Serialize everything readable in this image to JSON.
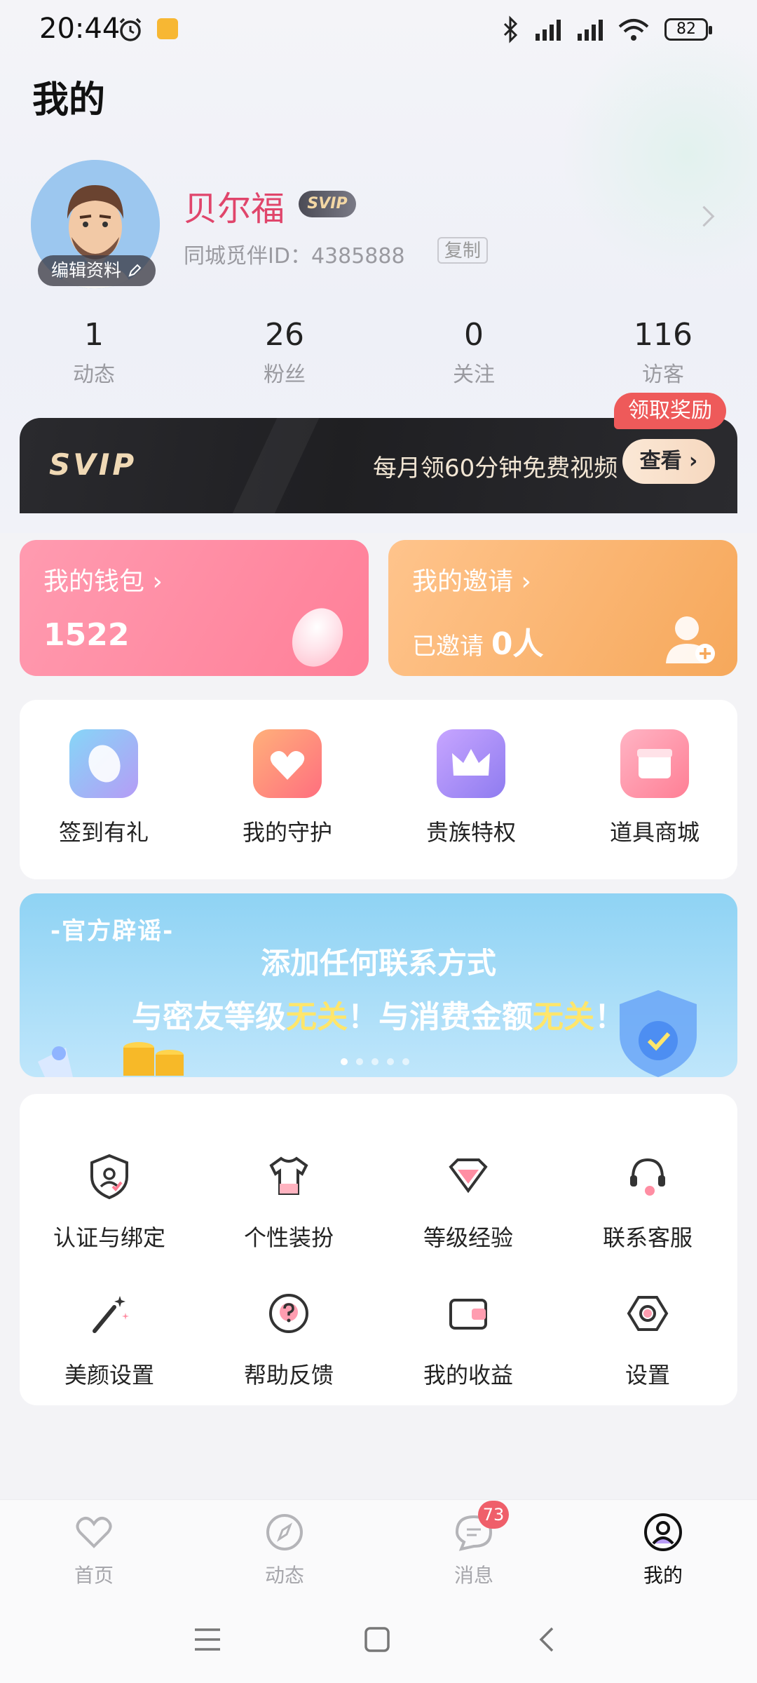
{
  "status_bar": {
    "time": "20:44",
    "battery": "82"
  },
  "page_title": "我的",
  "profile": {
    "edit_label": "编辑资料",
    "name": "贝尔福",
    "vip_tag": "SVIP",
    "uid_text": "同城觅伴ID：4385888",
    "copy_label": "复制"
  },
  "stats": [
    {
      "value": "1",
      "label": "动态"
    },
    {
      "value": "26",
      "label": "粉丝"
    },
    {
      "value": "0",
      "label": "关注"
    },
    {
      "value": "116",
      "label": "访客"
    }
  ],
  "svip_banner": {
    "logo": "SVIP",
    "desc": "每月领60分钟免费视频",
    "button": "查看 ›",
    "reward_badge": "领取奖励"
  },
  "wallet": {
    "title": "我的钱包 ›",
    "amount": "1522"
  },
  "invite": {
    "title": "我的邀请 ›",
    "prefix": "已邀请",
    "count": "0人"
  },
  "features": [
    {
      "label": "签到有礼",
      "icon": "bean-icon",
      "color": "#7fc3f4"
    },
    {
      "label": "我的守护",
      "icon": "guard-heart-icon",
      "color": "#ff8c6b"
    },
    {
      "label": "贵族特权",
      "icon": "crown-icon",
      "color": "#b79bf5"
    },
    {
      "label": "道具商城",
      "icon": "store-box-icon",
      "color": "#ff8fa3"
    }
  ],
  "rumor_banner": {
    "tag": "-官方辟谣-",
    "line1": "添加任何联系方式",
    "line2_a": "与密友等级",
    "line2_b": "无关",
    "line2_c": "！与消费金额",
    "line2_d": "无关",
    "line2_e": "！"
  },
  "tools": [
    {
      "label": "认证与绑定",
      "icon": "shield-user-icon"
    },
    {
      "label": "个性装扮",
      "icon": "tshirt-icon"
    },
    {
      "label": "等级经验",
      "icon": "diamond-icon"
    },
    {
      "label": "联系客服",
      "icon": "headset-icon"
    },
    {
      "label": "美颜设置",
      "icon": "magic-wand-icon"
    },
    {
      "label": "帮助反馈",
      "icon": "help-icon"
    },
    {
      "label": "我的收益",
      "icon": "wallet-icon"
    },
    {
      "label": "设置",
      "icon": "settings-icon"
    }
  ],
  "bottom_nav": {
    "items": [
      {
        "label": "首页",
        "icon": "heart-icon"
      },
      {
        "label": "动态",
        "icon": "compass-icon"
      },
      {
        "label": "消息",
        "icon": "chat-icon"
      },
      {
        "label": "我的",
        "icon": "profile-icon"
      }
    ],
    "message_badge": "73"
  },
  "colors": {
    "accent_pink": "#e0456b",
    "badge_red": "#ef5f6a"
  }
}
